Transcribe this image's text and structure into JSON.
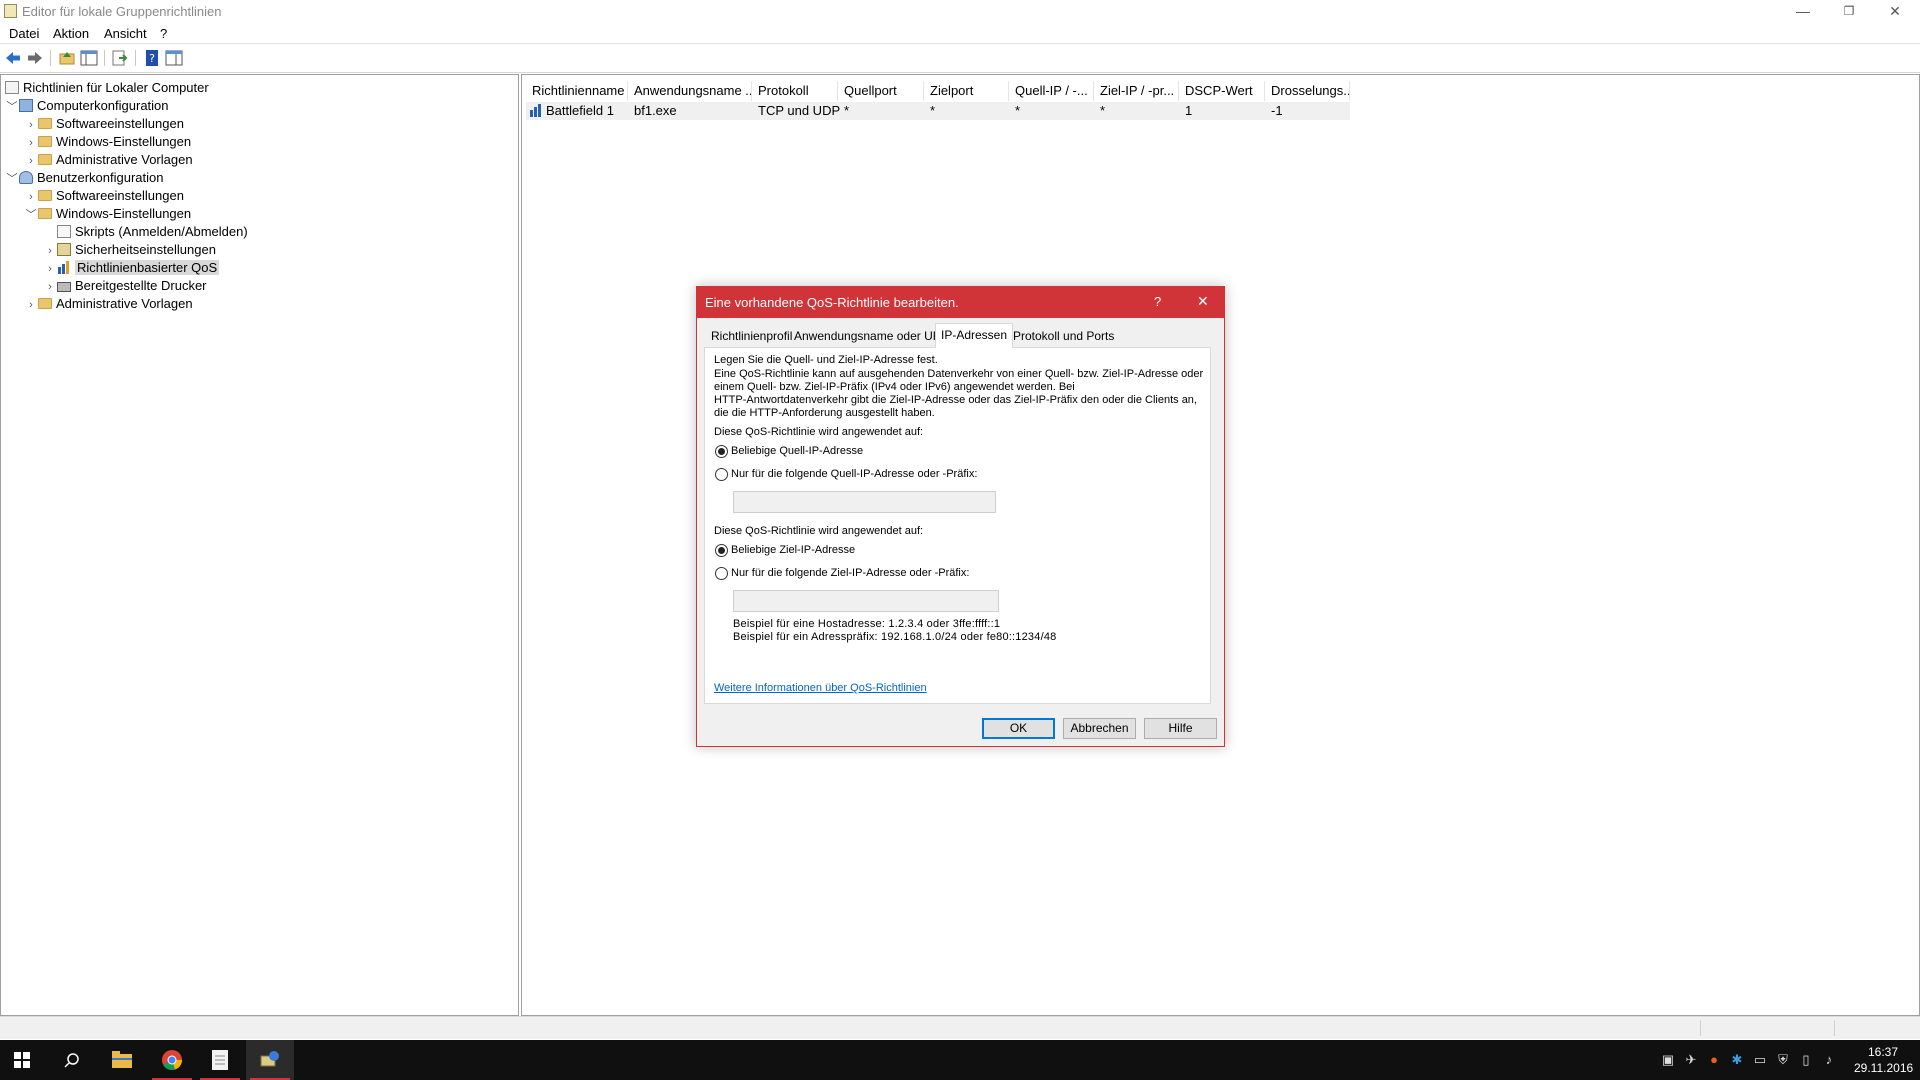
{
  "window": {
    "title": "Editor für lokale Gruppenrichtlinien",
    "minimize": "—",
    "restore": "❐",
    "close": "✕"
  },
  "menu": {
    "items": [
      "Datei",
      "Aktion",
      "Ansicht",
      "?"
    ]
  },
  "tree": {
    "root": "Richtlinien für Lokaler Computer",
    "computer": "Computerkonfiguration",
    "computer_children": [
      "Softwareeinstellungen",
      "Windows-Einstellungen",
      "Administrative Vorlagen"
    ],
    "user": "Benutzerkonfiguration",
    "user_children": [
      "Softwareeinstellungen",
      "Windows-Einstellungen"
    ],
    "user_windows_children": [
      "Skripts (Anmelden/Abmelden)",
      "Sicherheitseinstellungen",
      "Richtlinienbasierter QoS",
      "Bereitgestellte Drucker"
    ],
    "user_last": "Administrative Vorlagen"
  },
  "list": {
    "columns": [
      "Richtlinienname",
      "Anwendungsname ...",
      "Protokoll",
      "Quellport",
      "Zielport",
      "Quell-IP / -...",
      "Ziel-IP / -pr...",
      "DSCP-Wert",
      "Drosselungs..."
    ],
    "rows": [
      [
        "Battlefield 1",
        "bf1.exe",
        "TCP und UDP",
        "*",
        "*",
        "*",
        "*",
        "1",
        "-1"
      ]
    ]
  },
  "dialog": {
    "title": "Eine vorhandene QoS-Richtlinie bearbeiten.",
    "help_glyph": "?",
    "close_glyph": "✕",
    "tabs": [
      "Richtlinienprofil",
      "Anwendungsname oder URL",
      "IP-Adressen",
      "Protokoll und Ports"
    ],
    "active_tab": "IP-Adressen",
    "heading": "Legen Sie die Quell- und Ziel-IP-Adresse fest.",
    "description": [
      "Eine QoS-Richtlinie kann auf ausgehenden Datenverkehr von einer Quell- bzw. Ziel-IP-Adresse oder",
      "einem Quell- bzw. Ziel-IP-Präfix (IPv4 oder IPv6) angewendet werden. Bei",
      "HTTP-Antwortdatenverkehr gibt die Ziel-IP-Adresse oder das Ziel-IP-Präfix den oder die Clients an,",
      "die die HTTP-Anforderung ausgestellt haben."
    ],
    "source_label": "Diese QoS-Richtlinie wird angewendet auf:",
    "source_any": "Beliebige Quell-IP-Adresse",
    "source_specific": "Nur für die folgende Quell-IP-Adresse oder -Präfix:",
    "source_value": "",
    "dest_label": "Diese QoS-Richtlinie wird angewendet auf:",
    "dest_any": "Beliebige Ziel-IP-Adresse",
    "dest_specific": "Nur für die folgende Ziel-IP-Adresse oder -Präfix:",
    "dest_value": "",
    "example_host": "Beispiel für eine Hostadresse: 1.2.3.4 oder 3ffe:ffff::1",
    "example_prefix": "Beispiel für ein Adresspräfix: 192.168.1.0/24 oder fe80::1234/48",
    "more_info_link": "Weitere Informationen über QoS-Richtlinien",
    "buttons": {
      "ok": "OK",
      "cancel": "Abbrechen",
      "help": "Hilfe"
    }
  },
  "taskbar": {
    "clock_time": "16:37",
    "clock_date": "29.11.2016",
    "colors": {
      "background": "#101010",
      "accent": "#d13438"
    }
  }
}
